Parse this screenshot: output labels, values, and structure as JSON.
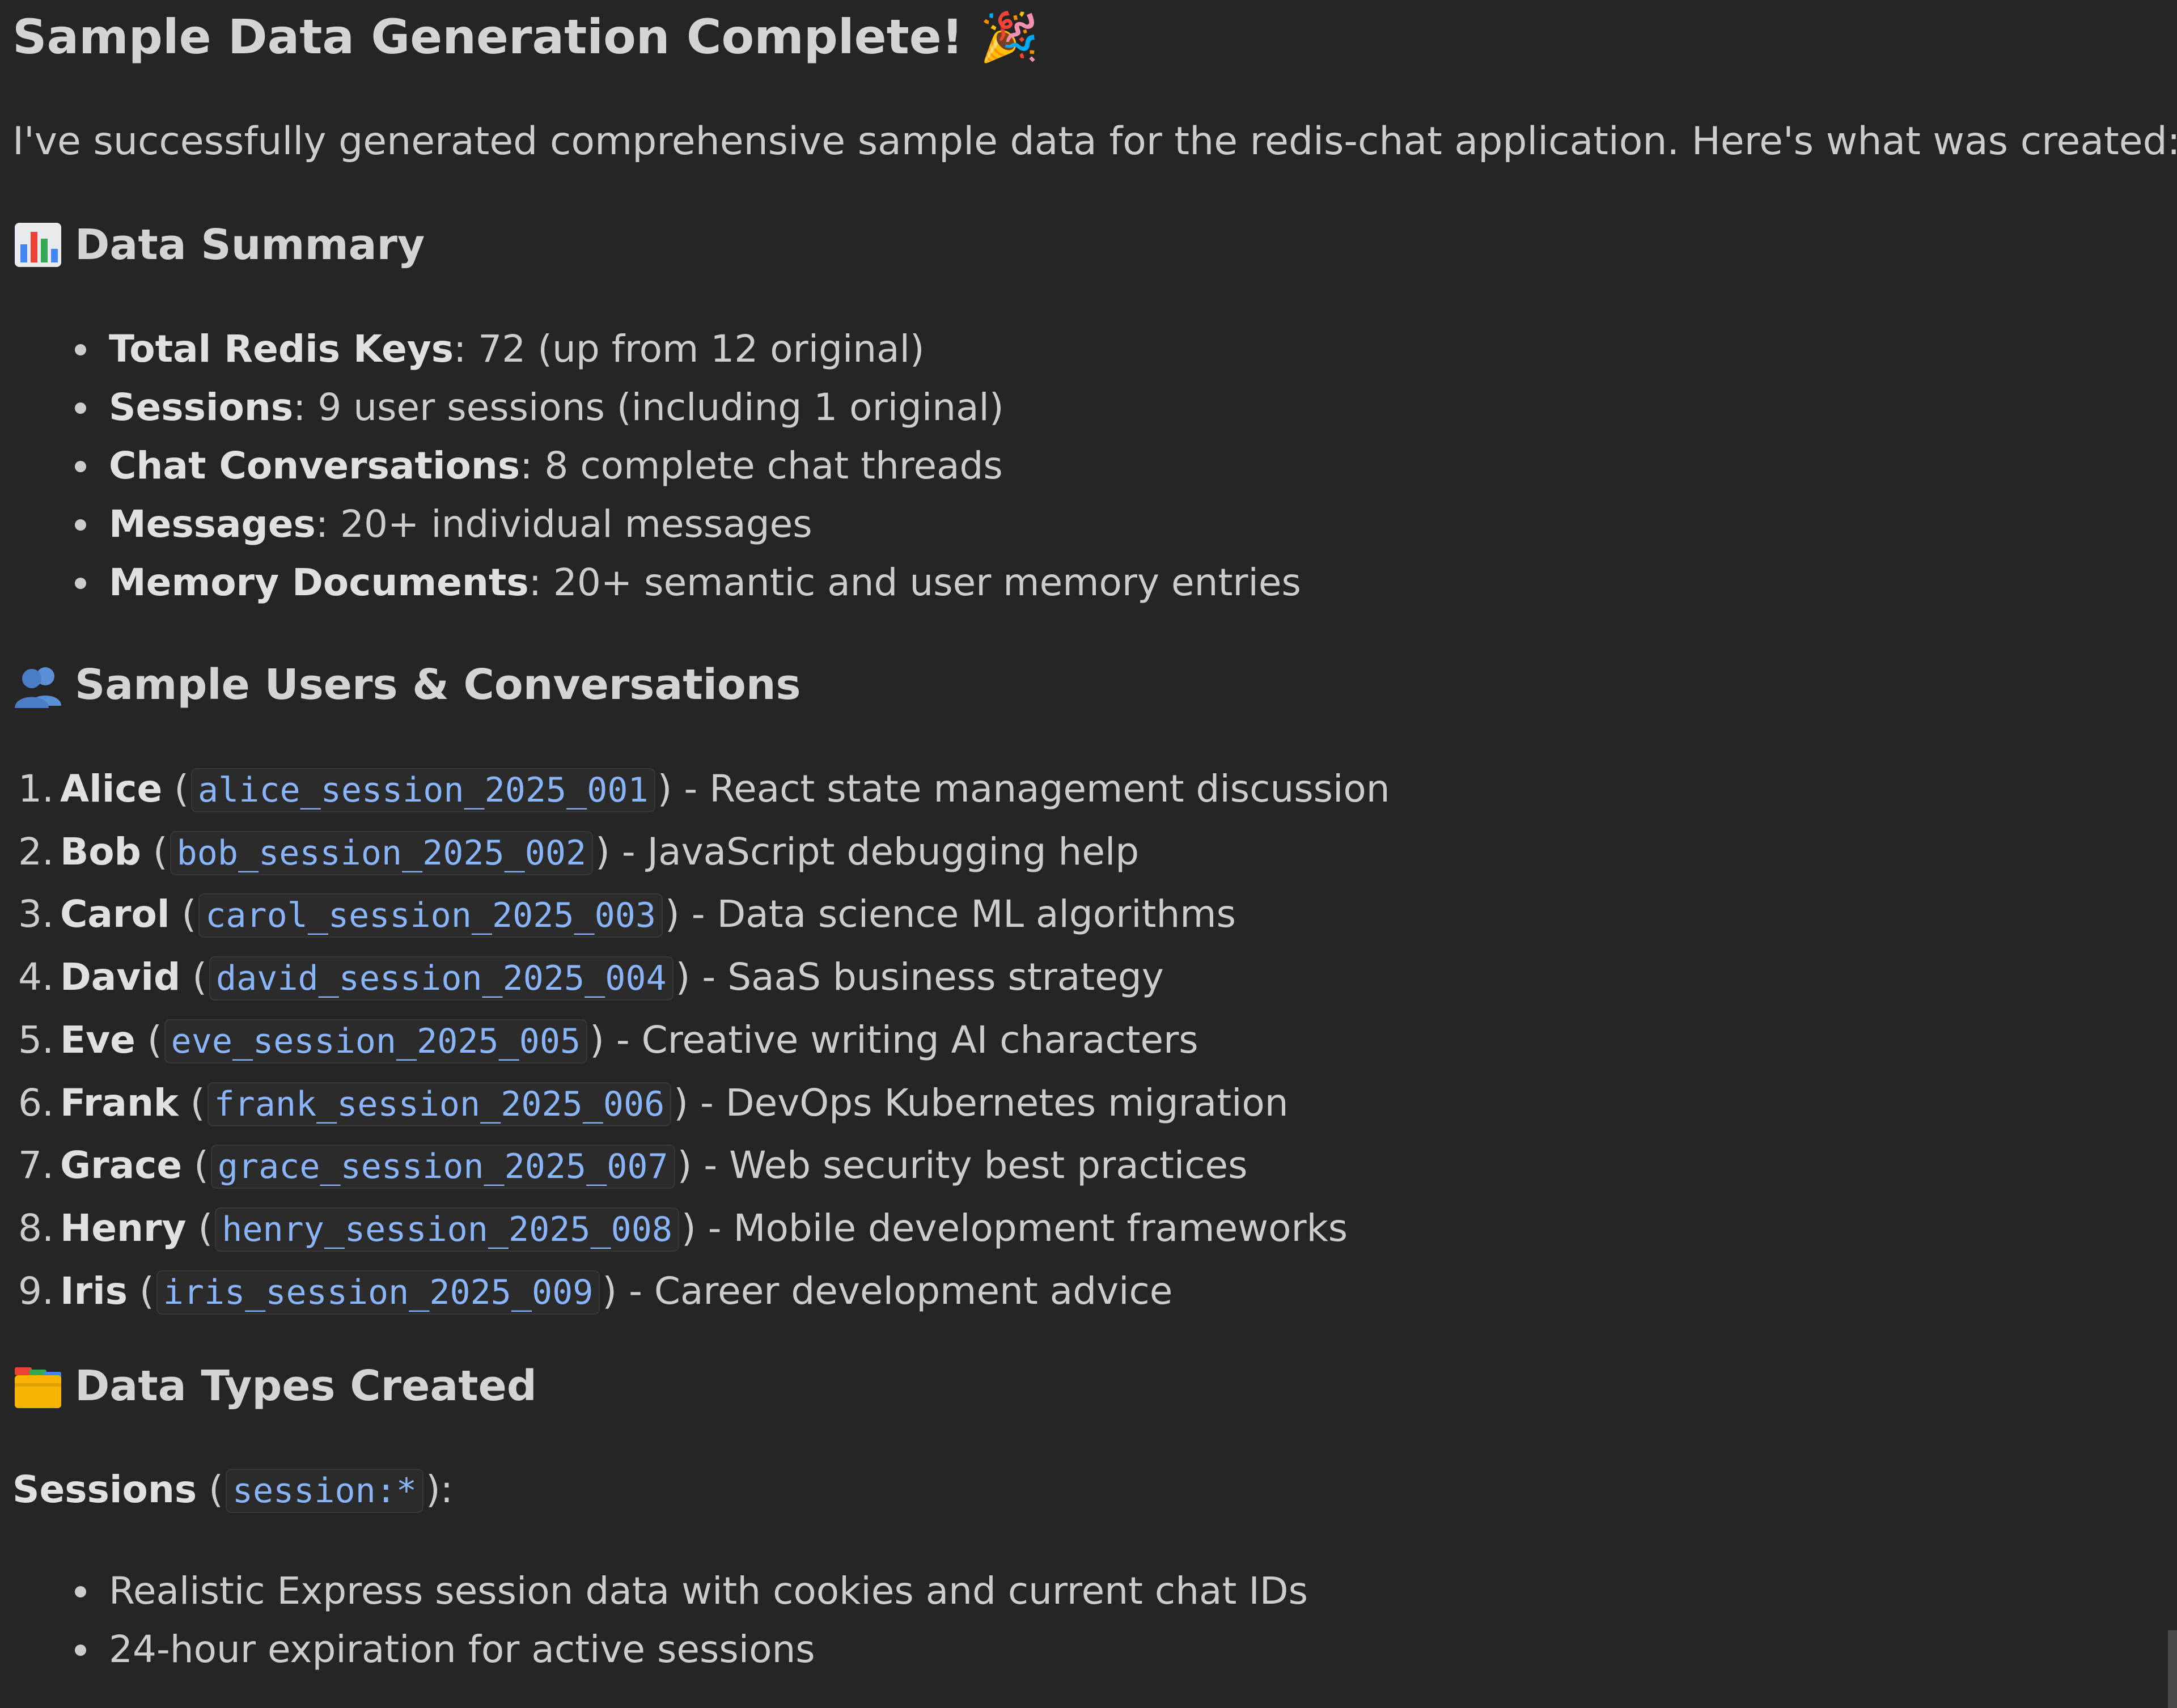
{
  "title": "Sample Data Generation Complete! 🎉",
  "intro": "I've successfully generated comprehensive sample data for the redis-chat application. Here's what was created:",
  "summary": {
    "heading": "Data Summary",
    "icon": "bar-chart-icon",
    "items": [
      {
        "label": "Total Redis Keys",
        "text": ": 72 (up from 12 original)"
      },
      {
        "label": "Sessions",
        "text": ": 9 user sessions (including 1 original)"
      },
      {
        "label": "Chat Conversations",
        "text": ": 8 complete chat threads"
      },
      {
        "label": "Messages",
        "text": ": 20+ individual messages"
      },
      {
        "label": "Memory Documents",
        "text": ": 20+ semantic and user memory entries"
      }
    ]
  },
  "users": {
    "heading": "Sample Users & Conversations",
    "icon": "people-icon",
    "items": [
      {
        "num": "1.",
        "name": "Alice",
        "session": "alice_session_2025_001",
        "desc": "- React state management discussion"
      },
      {
        "num": "2.",
        "name": "Bob",
        "session": "bob_session_2025_002",
        "desc": "- JavaScript debugging help"
      },
      {
        "num": "3.",
        "name": "Carol",
        "session": "carol_session_2025_003",
        "desc": "- Data science ML algorithms"
      },
      {
        "num": "4.",
        "name": "David",
        "session": "david_session_2025_004",
        "desc": "- SaaS business strategy"
      },
      {
        "num": "5.",
        "name": "Eve",
        "session": "eve_session_2025_005",
        "desc": "- Creative writing AI characters"
      },
      {
        "num": "6.",
        "name": "Frank",
        "session": "frank_session_2025_006",
        "desc": "- DevOps Kubernetes migration"
      },
      {
        "num": "7.",
        "name": "Grace",
        "session": "grace_session_2025_007",
        "desc": "- Web security best practices"
      },
      {
        "num": "8.",
        "name": "Henry",
        "session": "henry_session_2025_008",
        "desc": "- Mobile development frameworks"
      },
      {
        "num": "9.",
        "name": "Iris",
        "session": "iris_session_2025_009",
        "desc": "- Career development advice"
      }
    ]
  },
  "types": {
    "heading": "Data Types Created",
    "icon": "card-index-dividers-icon",
    "sessions_label": "Sessions",
    "sessions_code": "session:*",
    "sessions_suffix": "):",
    "sessions_items": [
      "Realistic Express session data with cookies and current chat IDs",
      "24-hour expiration for active sessions"
    ]
  }
}
